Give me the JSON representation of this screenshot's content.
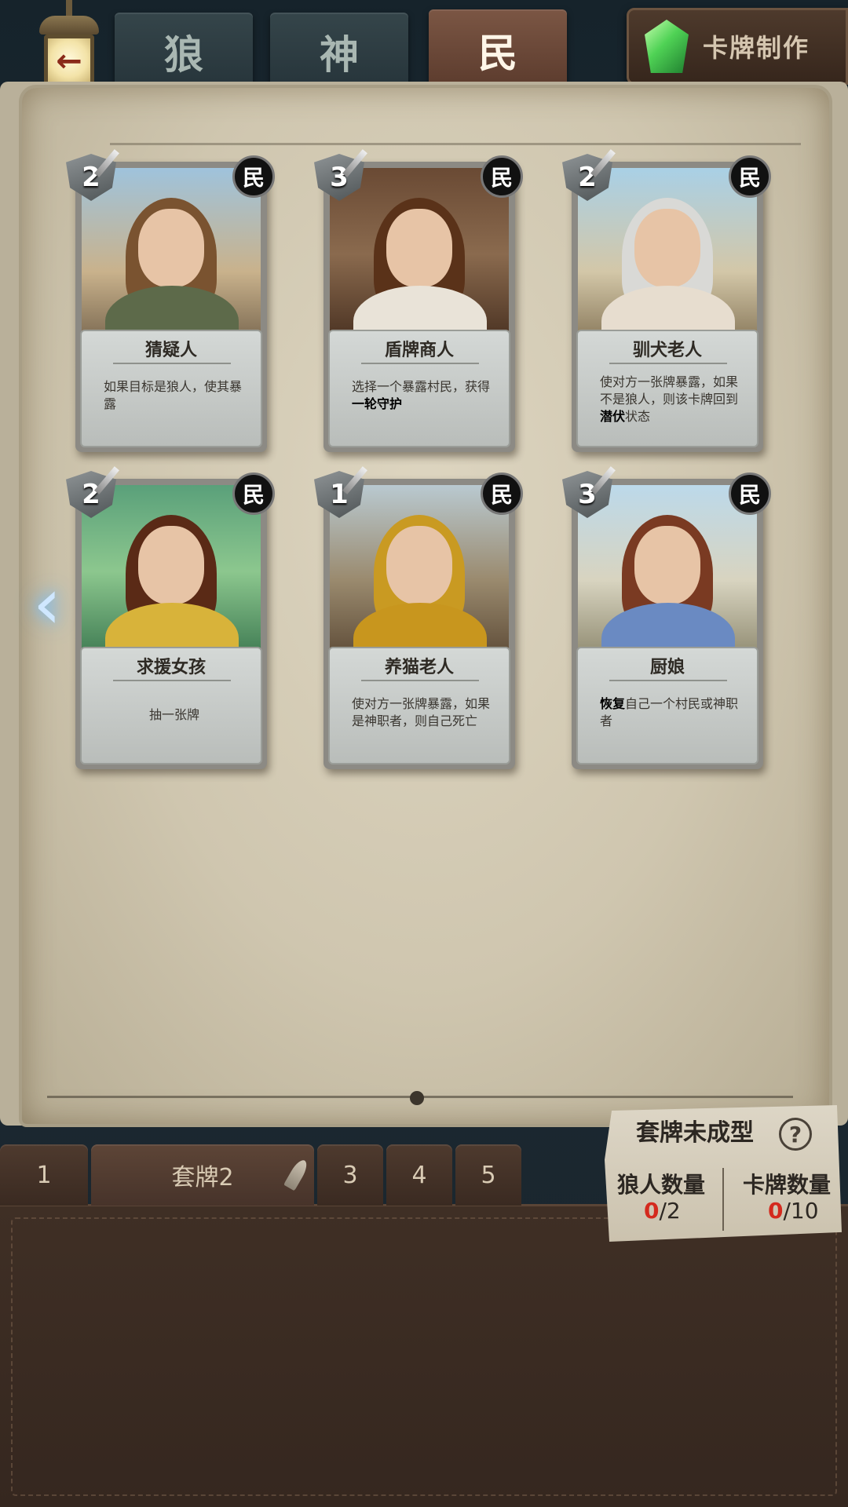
{
  "header": {
    "back_icon": "←",
    "tabs": [
      {
        "label": "狼",
        "active": false
      },
      {
        "label": "神",
        "active": false
      },
      {
        "label": "民",
        "active": true
      }
    ],
    "make_button_label": "卡牌制作"
  },
  "cards": [
    {
      "cost": "2",
      "faction": "民",
      "name": "猜疑人",
      "desc": "如果目标是狼人，使其暴露"
    },
    {
      "cost": "3",
      "faction": "民",
      "name": "盾牌商人",
      "desc_plain": "选择一个暴露村民，获得",
      "desc_bold": "一轮守护"
    },
    {
      "cost": "2",
      "faction": "民",
      "name": "驯犬老人",
      "desc_plain": "使对方一张牌暴露，如果不是狼人，则该卡牌回到",
      "desc_bold": "潜伏",
      "desc_tail": "状态"
    },
    {
      "cost": "2",
      "faction": "民",
      "name": "求援女孩",
      "desc": "抽一张牌"
    },
    {
      "cost": "1",
      "faction": "民",
      "name": "养猫老人",
      "desc": "使对方一张牌暴露，如果是神职者，则自己死亡"
    },
    {
      "cost": "3",
      "faction": "民",
      "name": "厨娘",
      "desc_bold": "恢复",
      "desc_tail": "自己一个村民或神职者"
    }
  ],
  "nav": {
    "prev_arrow": "‹"
  },
  "deck_tabs": [
    {
      "label": "1"
    },
    {
      "label": "套牌2",
      "active": true
    },
    {
      "label": "3"
    },
    {
      "label": "4"
    },
    {
      "label": "5"
    }
  ],
  "deck_status": {
    "title": "套牌未成型",
    "help_icon": "?",
    "wolf_label": "狼人数量",
    "wolf_current": "0",
    "wolf_max": "/2",
    "card_label": "卡牌数量",
    "card_current": "0",
    "card_max": "/10"
  },
  "colors": {
    "active_tab": "#6a4838",
    "count_red": "#d42a1e",
    "page": "#d4ccb6"
  }
}
